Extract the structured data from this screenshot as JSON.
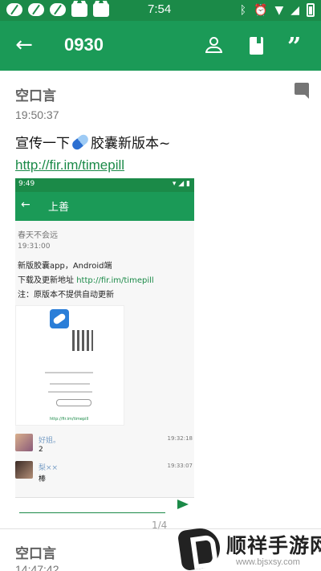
{
  "status_bar": {
    "time": "7:54"
  },
  "toolbar": {
    "title": "0930"
  },
  "post": {
    "author": "空口言",
    "time": "19:50:37",
    "content_before": "宣传一下",
    "content_after": "胶囊新版本~",
    "link": "http://fir.im/timepill"
  },
  "screenshot": {
    "status_time": "9:49",
    "title": "上善",
    "author": "春天不会远",
    "time": "19:31:00",
    "line1": "新版胶囊app，Android端",
    "line2_prefix": "下载及更新地址 ",
    "line2_link": "http://fir.im/timepill",
    "line3": "注：原版本不提供自动更新",
    "inner_url": "http://fir.im/timepill",
    "comments": [
      {
        "name": "好姐。",
        "text": "2",
        "time": "19:32:18"
      },
      {
        "name": "梨××",
        "text": "棒",
        "time": "19:33:07"
      }
    ]
  },
  "pager": "1/4",
  "next_post": {
    "author": "空口言",
    "time": "14:47:42"
  },
  "watermark": {
    "text": "顺祥手游网",
    "url": "www.bjsxsy.com"
  },
  "colors": {
    "primary": "#1b9a57",
    "primary_dark": "#1b8a48",
    "link": "#1b8a48"
  }
}
